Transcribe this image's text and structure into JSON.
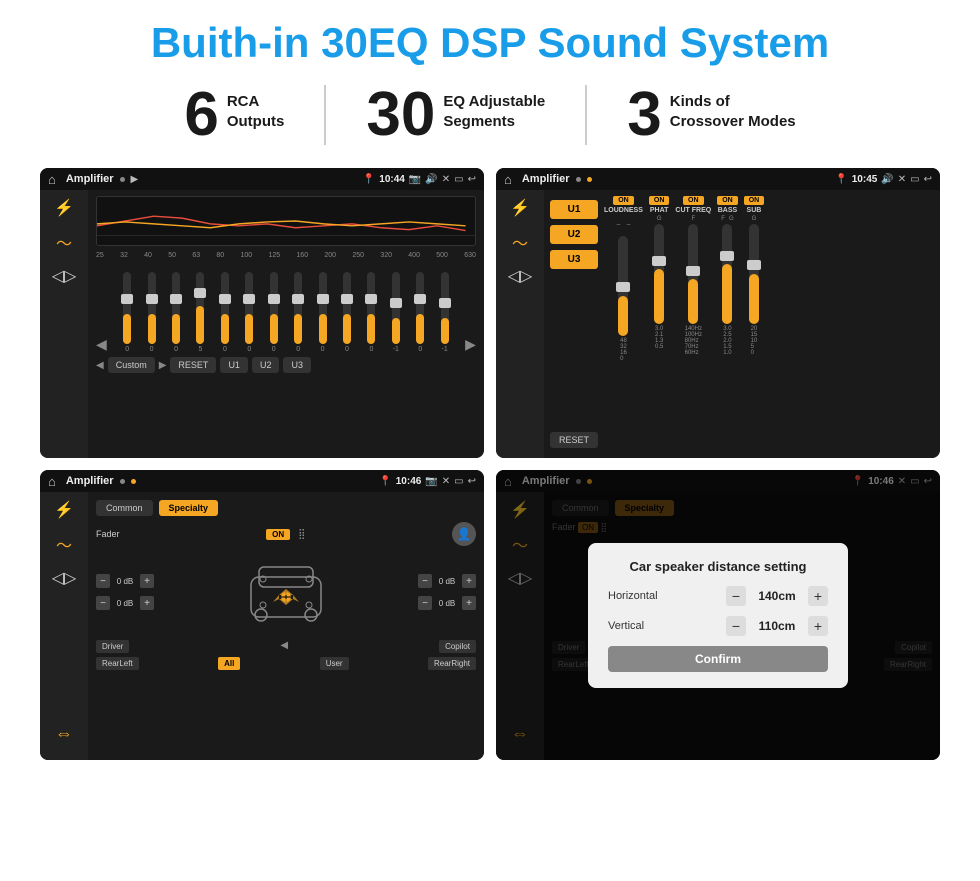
{
  "title": "Buith-in 30EQ DSP Sound System",
  "stats": [
    {
      "number": "6",
      "text": "RCA\nOutputs"
    },
    {
      "number": "30",
      "text": "EQ Adjustable\nSegments"
    },
    {
      "number": "3",
      "text": "Kinds of\nCrossover Modes"
    }
  ],
  "screens": [
    {
      "id": "eq-screen",
      "time": "10:44",
      "title": "Amplifier",
      "freqs": [
        "25",
        "32",
        "40",
        "50",
        "63",
        "80",
        "100",
        "125",
        "160",
        "200",
        "250",
        "320",
        "400",
        "500",
        "630"
      ],
      "values": [
        "0",
        "0",
        "0",
        "5",
        "0",
        "0",
        "0",
        "0",
        "0",
        "0",
        "0",
        "0",
        "-1",
        "0",
        "-1"
      ],
      "presets": [
        "Custom",
        "RESET",
        "U1",
        "U2",
        "U3"
      ]
    },
    {
      "id": "crossover-screen",
      "time": "10:45",
      "title": "Amplifier",
      "channels": [
        "U1",
        "U2",
        "U3"
      ],
      "controls": [
        "LOUDNESS",
        "PHAT",
        "CUT FREQ",
        "BASS",
        "SUB"
      ]
    },
    {
      "id": "fader-screen",
      "time": "10:46",
      "title": "Amplifier",
      "tabs": [
        "Common",
        "Specialty"
      ],
      "faderLabel": "Fader",
      "faderOn": "ON",
      "speakerValues": [
        "0 dB",
        "0 dB",
        "0 dB",
        "0 dB"
      ],
      "bottomLabels": [
        "Driver",
        "Copilot",
        "RearLeft",
        "All",
        "User",
        "RearRight"
      ]
    },
    {
      "id": "distance-screen",
      "time": "10:46",
      "title": "Amplifier",
      "dialog": {
        "title": "Car speaker distance setting",
        "rows": [
          {
            "label": "Horizontal",
            "value": "140cm"
          },
          {
            "label": "Vertical",
            "value": "110cm"
          }
        ],
        "confirm": "Confirm"
      }
    }
  ]
}
